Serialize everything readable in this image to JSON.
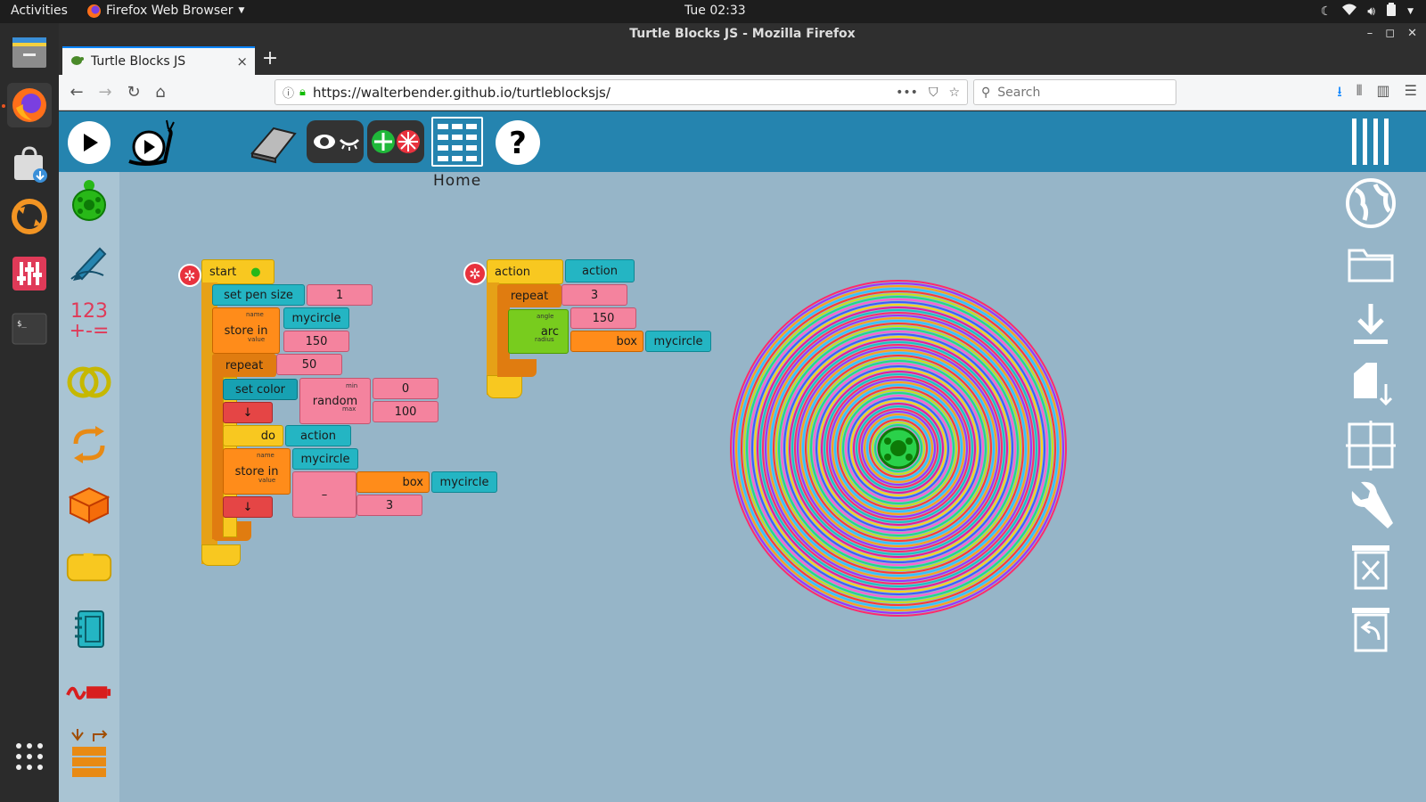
{
  "topbar": {
    "activities": "Activities",
    "app_menu": "Firefox Web Browser",
    "clock": "Tue 02:33"
  },
  "window": {
    "title": "Turtle Blocks JS - Mozilla Firefox"
  },
  "tab": {
    "title": "Turtle Blocks JS",
    "close": "×",
    "new_tab": "+"
  },
  "nav": {
    "url": "https://walterbender.github.io/turtleblocksjs/",
    "search_placeholder": "Search",
    "more": "•••"
  },
  "toolbar": {
    "home_label": "Home",
    "help": "?"
  },
  "palette": {
    "number_label_top": "123",
    "number_label_bottom": "+-="
  },
  "stack1": {
    "start_label": "start",
    "set_pen_size_label": "set pen size",
    "set_pen_size_value": "1",
    "store1_label": "store in",
    "store1_name_hint": "name",
    "store1_value_hint": "value",
    "store1_name": "mycircle",
    "store1_value": "150",
    "repeat_label": "repeat",
    "repeat_value": "50",
    "set_color_label": "set color",
    "random_label": "random",
    "random_min_hint": "min",
    "random_max_hint": "max",
    "random_min": "0",
    "random_max": "100",
    "arrow1": "↓",
    "do_label": "do",
    "do_value": "action",
    "store2_label": "store in",
    "store2_name_hint": "name",
    "store2_value_hint": "value",
    "store2_name": "mycircle",
    "minus_label": "–",
    "box_label": "box",
    "box_value": "mycircle",
    "minus_value": "3",
    "arrow2": "↓"
  },
  "stack2": {
    "action_label": "action",
    "action_name": "action",
    "repeat_label": "repeat",
    "repeat_value": "3",
    "arc_label": "arc",
    "arc_angle_hint": "angle",
    "arc_radius_hint": "radius",
    "arc_angle": "150",
    "box_label": "box",
    "box_value": "mycircle"
  },
  "colors": {
    "toolbar_blue": "#2584af",
    "canvas_bg": "#96b5c8",
    "palette_bg": "#a9c4d3"
  }
}
